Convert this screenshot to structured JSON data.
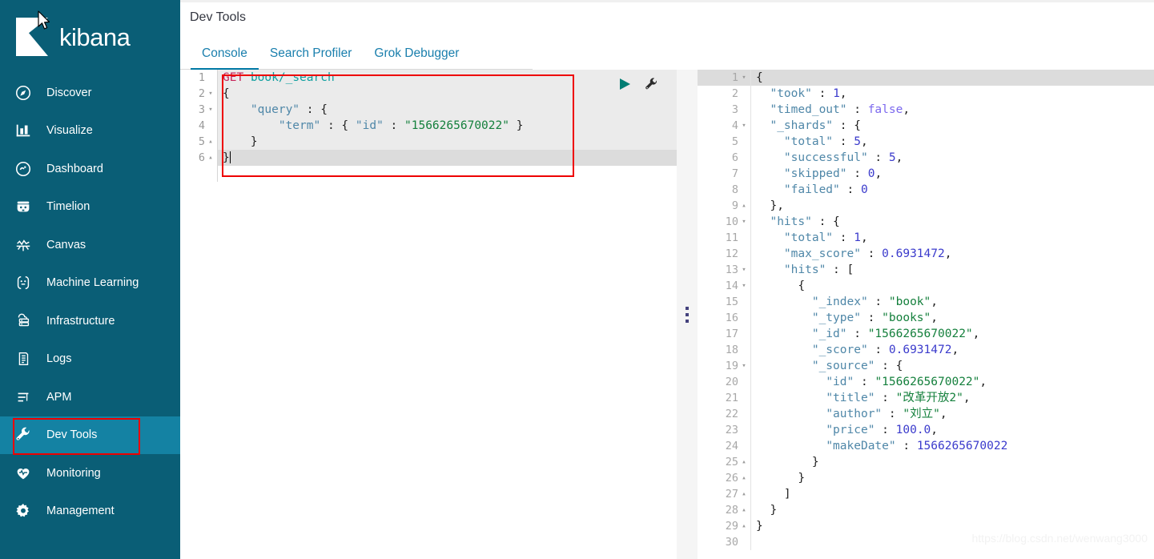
{
  "app": {
    "brand_name": "kibana",
    "logo_icon": "kibana-logo"
  },
  "sidebar": {
    "items": [
      {
        "label": "Discover",
        "icon": "compass-icon",
        "active": false
      },
      {
        "label": "Visualize",
        "icon": "bar-chart-icon",
        "active": false
      },
      {
        "label": "Dashboard",
        "icon": "dashboard-icon",
        "active": false
      },
      {
        "label": "Timelion",
        "icon": "timelion-icon",
        "active": false
      },
      {
        "label": "Canvas",
        "icon": "canvas-icon",
        "active": false
      },
      {
        "label": "Machine Learning",
        "icon": "ml-icon",
        "active": false
      },
      {
        "label": "Infrastructure",
        "icon": "server-icon",
        "active": false
      },
      {
        "label": "Logs",
        "icon": "logs-icon",
        "active": false
      },
      {
        "label": "APM",
        "icon": "apm-icon",
        "active": false
      },
      {
        "label": "Dev Tools",
        "icon": "wrench-icon",
        "active": true
      },
      {
        "label": "Monitoring",
        "icon": "heart-icon",
        "active": false
      },
      {
        "label": "Management",
        "icon": "gear-icon",
        "active": false
      }
    ]
  },
  "header": {
    "title": "Dev Tools",
    "tabs": [
      {
        "label": "Console",
        "active": true
      },
      {
        "label": "Search Profiler",
        "active": false
      },
      {
        "label": "Grok Debugger",
        "active": false
      }
    ]
  },
  "toolbar": {
    "play_icon": "play-triangle-icon",
    "wrench_icon": "wrench-icon"
  },
  "splitter": {
    "handle_icon": "vertical-dots-handle"
  },
  "request_editor": {
    "active_line": 6,
    "lines": [
      {
        "n": 1,
        "fold": "",
        "active": false,
        "tokens": [
          {
            "t": "GET",
            "c": "t-method"
          },
          {
            "t": " ",
            "c": "t-punct"
          },
          {
            "t": "book/_search",
            "c": "t-url"
          }
        ]
      },
      {
        "n": 2,
        "fold": "▾",
        "active": false,
        "tokens": [
          {
            "t": "{",
            "c": "t-punct"
          }
        ]
      },
      {
        "n": 3,
        "fold": "▾",
        "active": false,
        "tokens": [
          {
            "t": "    ",
            "c": "t-punct"
          },
          {
            "t": "\"query\"",
            "c": "t-key"
          },
          {
            "t": " : {",
            "c": "t-punct"
          }
        ]
      },
      {
        "n": 4,
        "fold": "",
        "active": false,
        "tokens": [
          {
            "t": "        ",
            "c": "t-punct"
          },
          {
            "t": "\"term\"",
            "c": "t-key"
          },
          {
            "t": " : { ",
            "c": "t-punct"
          },
          {
            "t": "\"id\"",
            "c": "t-key"
          },
          {
            "t": " : ",
            "c": "t-punct"
          },
          {
            "t": "\"1566265670022\"",
            "c": "t-str"
          },
          {
            "t": " }",
            "c": "t-punct"
          }
        ]
      },
      {
        "n": 5,
        "fold": "▴",
        "active": false,
        "tokens": [
          {
            "t": "    }",
            "c": "t-punct"
          }
        ]
      },
      {
        "n": 6,
        "fold": "▴",
        "active": true,
        "tokens": [
          {
            "t": "}",
            "c": "t-punct"
          }
        ]
      }
    ]
  },
  "response_editor": {
    "active_line": 1,
    "lines": [
      {
        "n": 1,
        "fold": "▾",
        "active": true,
        "tokens": [
          {
            "t": "{",
            "c": "t-punct"
          }
        ]
      },
      {
        "n": 2,
        "fold": "",
        "active": false,
        "tokens": [
          {
            "t": "  ",
            "c": "t-punct"
          },
          {
            "t": "\"took\"",
            "c": "t-key"
          },
          {
            "t": " : ",
            "c": "t-punct"
          },
          {
            "t": "1",
            "c": "t-num"
          },
          {
            "t": ",",
            "c": "t-punct"
          }
        ]
      },
      {
        "n": 3,
        "fold": "",
        "active": false,
        "tokens": [
          {
            "t": "  ",
            "c": "t-punct"
          },
          {
            "t": "\"timed_out\"",
            "c": "t-key"
          },
          {
            "t": " : ",
            "c": "t-punct"
          },
          {
            "t": "false",
            "c": "t-bool"
          },
          {
            "t": ",",
            "c": "t-punct"
          }
        ]
      },
      {
        "n": 4,
        "fold": "▾",
        "active": false,
        "tokens": [
          {
            "t": "  ",
            "c": "t-punct"
          },
          {
            "t": "\"_shards\"",
            "c": "t-key"
          },
          {
            "t": " : {",
            "c": "t-punct"
          }
        ]
      },
      {
        "n": 5,
        "fold": "",
        "active": false,
        "tokens": [
          {
            "t": "    ",
            "c": "t-punct"
          },
          {
            "t": "\"total\"",
            "c": "t-key"
          },
          {
            "t": " : ",
            "c": "t-punct"
          },
          {
            "t": "5",
            "c": "t-num"
          },
          {
            "t": ",",
            "c": "t-punct"
          }
        ]
      },
      {
        "n": 6,
        "fold": "",
        "active": false,
        "tokens": [
          {
            "t": "    ",
            "c": "t-punct"
          },
          {
            "t": "\"successful\"",
            "c": "t-key"
          },
          {
            "t": " : ",
            "c": "t-punct"
          },
          {
            "t": "5",
            "c": "t-num"
          },
          {
            "t": ",",
            "c": "t-punct"
          }
        ]
      },
      {
        "n": 7,
        "fold": "",
        "active": false,
        "tokens": [
          {
            "t": "    ",
            "c": "t-punct"
          },
          {
            "t": "\"skipped\"",
            "c": "t-key"
          },
          {
            "t": " : ",
            "c": "t-punct"
          },
          {
            "t": "0",
            "c": "t-num"
          },
          {
            "t": ",",
            "c": "t-punct"
          }
        ]
      },
      {
        "n": 8,
        "fold": "",
        "active": false,
        "tokens": [
          {
            "t": "    ",
            "c": "t-punct"
          },
          {
            "t": "\"failed\"",
            "c": "t-key"
          },
          {
            "t": " : ",
            "c": "t-punct"
          },
          {
            "t": "0",
            "c": "t-num"
          }
        ]
      },
      {
        "n": 9,
        "fold": "▴",
        "active": false,
        "tokens": [
          {
            "t": "  },",
            "c": "t-punct"
          }
        ]
      },
      {
        "n": 10,
        "fold": "▾",
        "active": false,
        "tokens": [
          {
            "t": "  ",
            "c": "t-punct"
          },
          {
            "t": "\"hits\"",
            "c": "t-key"
          },
          {
            "t": " : {",
            "c": "t-punct"
          }
        ]
      },
      {
        "n": 11,
        "fold": "",
        "active": false,
        "tokens": [
          {
            "t": "    ",
            "c": "t-punct"
          },
          {
            "t": "\"total\"",
            "c": "t-key"
          },
          {
            "t": " : ",
            "c": "t-punct"
          },
          {
            "t": "1",
            "c": "t-num"
          },
          {
            "t": ",",
            "c": "t-punct"
          }
        ]
      },
      {
        "n": 12,
        "fold": "",
        "active": false,
        "tokens": [
          {
            "t": "    ",
            "c": "t-punct"
          },
          {
            "t": "\"max_score\"",
            "c": "t-key"
          },
          {
            "t": " : ",
            "c": "t-punct"
          },
          {
            "t": "0.6931472",
            "c": "t-num"
          },
          {
            "t": ",",
            "c": "t-punct"
          }
        ]
      },
      {
        "n": 13,
        "fold": "▾",
        "active": false,
        "tokens": [
          {
            "t": "    ",
            "c": "t-punct"
          },
          {
            "t": "\"hits\"",
            "c": "t-key"
          },
          {
            "t": " : [",
            "c": "t-punct"
          }
        ]
      },
      {
        "n": 14,
        "fold": "▾",
        "active": false,
        "tokens": [
          {
            "t": "      {",
            "c": "t-punct"
          }
        ]
      },
      {
        "n": 15,
        "fold": "",
        "active": false,
        "tokens": [
          {
            "t": "        ",
            "c": "t-punct"
          },
          {
            "t": "\"_index\"",
            "c": "t-key"
          },
          {
            "t": " : ",
            "c": "t-punct"
          },
          {
            "t": "\"book\"",
            "c": "t-str"
          },
          {
            "t": ",",
            "c": "t-punct"
          }
        ]
      },
      {
        "n": 16,
        "fold": "",
        "active": false,
        "tokens": [
          {
            "t": "        ",
            "c": "t-punct"
          },
          {
            "t": "\"_type\"",
            "c": "t-key"
          },
          {
            "t": " : ",
            "c": "t-punct"
          },
          {
            "t": "\"books\"",
            "c": "t-str"
          },
          {
            "t": ",",
            "c": "t-punct"
          }
        ]
      },
      {
        "n": 17,
        "fold": "",
        "active": false,
        "tokens": [
          {
            "t": "        ",
            "c": "t-punct"
          },
          {
            "t": "\"_id\"",
            "c": "t-key"
          },
          {
            "t": " : ",
            "c": "t-punct"
          },
          {
            "t": "\"1566265670022\"",
            "c": "t-str"
          },
          {
            "t": ",",
            "c": "t-punct"
          }
        ]
      },
      {
        "n": 18,
        "fold": "",
        "active": false,
        "tokens": [
          {
            "t": "        ",
            "c": "t-punct"
          },
          {
            "t": "\"_score\"",
            "c": "t-key"
          },
          {
            "t": " : ",
            "c": "t-punct"
          },
          {
            "t": "0.6931472",
            "c": "t-num"
          },
          {
            "t": ",",
            "c": "t-punct"
          }
        ]
      },
      {
        "n": 19,
        "fold": "▾",
        "active": false,
        "tokens": [
          {
            "t": "        ",
            "c": "t-punct"
          },
          {
            "t": "\"_source\"",
            "c": "t-key"
          },
          {
            "t": " : {",
            "c": "t-punct"
          }
        ]
      },
      {
        "n": 20,
        "fold": "",
        "active": false,
        "tokens": [
          {
            "t": "          ",
            "c": "t-punct"
          },
          {
            "t": "\"id\"",
            "c": "t-key"
          },
          {
            "t": " : ",
            "c": "t-punct"
          },
          {
            "t": "\"1566265670022\"",
            "c": "t-str"
          },
          {
            "t": ",",
            "c": "t-punct"
          }
        ]
      },
      {
        "n": 21,
        "fold": "",
        "active": false,
        "tokens": [
          {
            "t": "          ",
            "c": "t-punct"
          },
          {
            "t": "\"title\"",
            "c": "t-key"
          },
          {
            "t": " : ",
            "c": "t-punct"
          },
          {
            "t": "\"改革开放2\"",
            "c": "t-str"
          },
          {
            "t": ",",
            "c": "t-punct"
          }
        ]
      },
      {
        "n": 22,
        "fold": "",
        "active": false,
        "tokens": [
          {
            "t": "          ",
            "c": "t-punct"
          },
          {
            "t": "\"author\"",
            "c": "t-key"
          },
          {
            "t": " : ",
            "c": "t-punct"
          },
          {
            "t": "\"刘立\"",
            "c": "t-str"
          },
          {
            "t": ",",
            "c": "t-punct"
          }
        ]
      },
      {
        "n": 23,
        "fold": "",
        "active": false,
        "tokens": [
          {
            "t": "          ",
            "c": "t-punct"
          },
          {
            "t": "\"price\"",
            "c": "t-key"
          },
          {
            "t": " : ",
            "c": "t-punct"
          },
          {
            "t": "100.0",
            "c": "t-num"
          },
          {
            "t": ",",
            "c": "t-punct"
          }
        ]
      },
      {
        "n": 24,
        "fold": "",
        "active": false,
        "tokens": [
          {
            "t": "          ",
            "c": "t-punct"
          },
          {
            "t": "\"makeDate\"",
            "c": "t-key"
          },
          {
            "t": " : ",
            "c": "t-punct"
          },
          {
            "t": "1566265670022",
            "c": "t-num"
          }
        ]
      },
      {
        "n": 25,
        "fold": "▴",
        "active": false,
        "tokens": [
          {
            "t": "        }",
            "c": "t-punct"
          }
        ]
      },
      {
        "n": 26,
        "fold": "▴",
        "active": false,
        "tokens": [
          {
            "t": "      }",
            "c": "t-punct"
          }
        ]
      },
      {
        "n": 27,
        "fold": "▴",
        "active": false,
        "tokens": [
          {
            "t": "    ]",
            "c": "t-punct"
          }
        ]
      },
      {
        "n": 28,
        "fold": "▴",
        "active": false,
        "tokens": [
          {
            "t": "  }",
            "c": "t-punct"
          }
        ]
      },
      {
        "n": 29,
        "fold": "▴",
        "active": false,
        "tokens": [
          {
            "t": "}",
            "c": "t-punct"
          }
        ]
      },
      {
        "n": 30,
        "fold": "",
        "active": false,
        "tokens": [
          {
            "t": "",
            "c": "t-punct"
          }
        ]
      }
    ]
  },
  "watermark": {
    "text": "https://blog.csdn.net/wenwang3000"
  },
  "colors": {
    "sidebar_bg": "#0a5e76",
    "sidebar_active_bg": "#1482a3",
    "annotation": "#ee0000",
    "tab_active": "#0079a5",
    "method": "#c7255a",
    "url": "#0d9e9e",
    "key": "#4f87a8",
    "string": "#15803d",
    "number": "#3b3bcc",
    "boolean": "#7b68ee",
    "play": "#017d73"
  }
}
